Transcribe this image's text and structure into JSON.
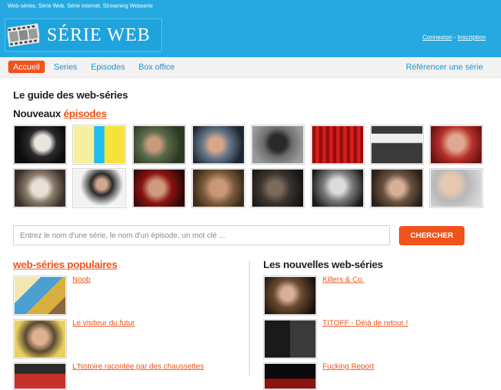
{
  "header": {
    "tagline": "Web-séries. Série Web. Série internet. Streaming Webserie",
    "logo_text": "SÉRIE WEB",
    "login": "Connexion",
    "separator": " - ",
    "signup": "Inscription"
  },
  "nav": {
    "items": [
      "Accueil",
      "Series",
      "Episodes",
      "Box office"
    ],
    "right": "Référencer une série"
  },
  "main": {
    "title": "Le guide des web-séries",
    "new_prefix": "Nouveaux ",
    "new_link": "épisodes"
  },
  "search": {
    "placeholder": "Entrez le nom d'une série, le nom d'un épisode, un mot clé ...",
    "button": "CHERCHER"
  },
  "popular": {
    "title": "web-séries populaires",
    "items": [
      "Noob",
      "Le visiteur du futur",
      "L'histoire racontée par des chaussettes"
    ]
  },
  "newest": {
    "title": "Les nouvelles web-séries",
    "items": [
      "Killers & Co.",
      "TITOFF - Déjà de retour !",
      "Fucking Report"
    ]
  },
  "colors": {
    "header_blue": "#26a9e0",
    "accent_orange": "#f0531c",
    "nav_link": "#1f8fd2"
  }
}
